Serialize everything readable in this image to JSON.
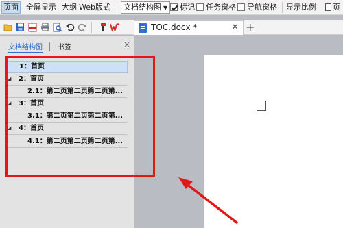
{
  "ribbon": {
    "view_page": "页面",
    "view_fullscreen": "全屏显示",
    "view_outline": "大纲",
    "view_web": "Web版式",
    "doc_structure_select": "文档结构图",
    "markup_label": "标记",
    "markup_checked": true,
    "task_pane_label": "任务窗格",
    "task_pane_checked": false,
    "nav_pane_label": "导航窗格",
    "nav_pane_checked": false,
    "zoom_label": "显示比例",
    "page_width_label": "页"
  },
  "toolbar": {
    "icons": [
      "open-folder-icon",
      "save-icon",
      "pdf-export-icon",
      "print-icon",
      "print-preview-icon",
      "undo-icon",
      "redo-icon",
      "format-painter-icon",
      "wps-logo-icon"
    ]
  },
  "tabs": {
    "document_tab": "TOC.docx *",
    "close_glyph": "×",
    "add_glyph": "+"
  },
  "navpane": {
    "tab_structure": "文档结构图",
    "tab_bookmarks": "书签",
    "close_glyph": "×",
    "items": [
      {
        "level": 1,
        "text": "1：首页",
        "expanded": null,
        "selected": true
      },
      {
        "level": 1,
        "text": "2：首页",
        "expanded": true,
        "selected": false
      },
      {
        "level": 2,
        "text": "2.1：第二页第二页第二页第...",
        "expanded": null,
        "selected": false
      },
      {
        "level": 1,
        "text": "3：首页",
        "expanded": true,
        "selected": false
      },
      {
        "level": 2,
        "text": "3.1：第二页第二页第二页第...",
        "expanded": null,
        "selected": false
      },
      {
        "level": 1,
        "text": "4：首页",
        "expanded": true,
        "selected": false
      },
      {
        "level": 2,
        "text": "4.1：第二页第二页第二页第...",
        "expanded": null,
        "selected": false
      }
    ]
  },
  "colors": {
    "highlight_red": "#e01818",
    "accent_blue": "#2f6fd4",
    "selection_blue": "#cde0f7"
  }
}
